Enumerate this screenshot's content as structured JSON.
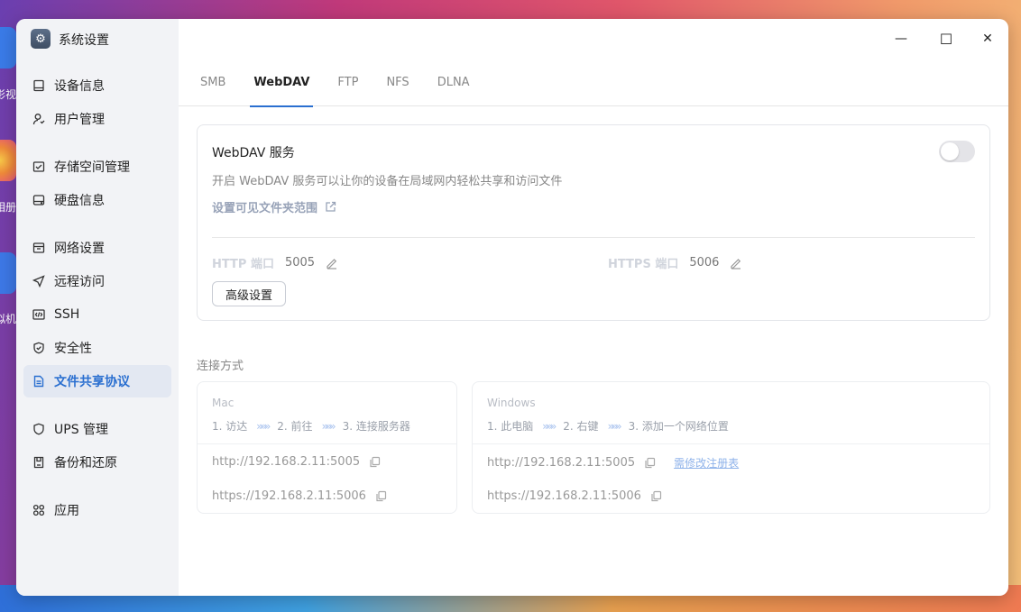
{
  "desktop": {
    "labels": [
      "影视",
      "相册",
      "虚拟机"
    ]
  },
  "window": {
    "title": "系统设置",
    "minimize_label": "—",
    "maximize_label": "☐",
    "close_label": "✕"
  },
  "sidebar": {
    "items": [
      {
        "label": "设备信息",
        "icon": "device-icon"
      },
      {
        "label": "用户管理",
        "icon": "user-icon"
      },
      {
        "label": "存储空间管理",
        "icon": "storage-icon"
      },
      {
        "label": "硬盘信息",
        "icon": "disk-icon"
      },
      {
        "label": "网络设置",
        "icon": "network-icon"
      },
      {
        "label": "远程访问",
        "icon": "send-icon"
      },
      {
        "label": "SSH",
        "icon": "code-icon"
      },
      {
        "label": "安全性",
        "icon": "shield-icon"
      },
      {
        "label": "文件共享协议",
        "icon": "file-icon",
        "active": true
      },
      {
        "label": "UPS 管理",
        "icon": "ups-shield-icon"
      },
      {
        "label": "备份和还原",
        "icon": "backup-icon"
      },
      {
        "label": "应用",
        "icon": "apps-icon"
      }
    ]
  },
  "tabs": [
    {
      "label": "SMB"
    },
    {
      "label": "WebDAV",
      "active": true
    },
    {
      "label": "FTP"
    },
    {
      "label": "NFS"
    },
    {
      "label": "DLNA"
    }
  ],
  "webdav": {
    "title": "WebDAV 服务",
    "enabled": false,
    "description": "开启 WebDAV 服务可以让你的设备在局域网内轻松共享和访问文件",
    "folder_scope_link": "设置可见文件夹范围",
    "http_port_label": "HTTP 端口",
    "http_port": "5005",
    "https_port_label": "HTTPS 端口",
    "https_port": "5006",
    "advanced_button": "高级设置"
  },
  "connection": {
    "title": "连接方式",
    "mac": {
      "os": "Mac",
      "steps": [
        "1. 访达",
        "2. 前往",
        "3. 连接服务器"
      ],
      "http_url": "http://192.168.2.11:5005",
      "https_url": "https://192.168.2.11:5006"
    },
    "windows": {
      "os": "Windows",
      "steps": [
        "1. 此电脑",
        "2. 右键",
        "3. 添加一个网络位置"
      ],
      "http_url": "http://192.168.2.11:5005",
      "registry_link": "需修改注册表",
      "https_url": "https://192.168.2.11:5006"
    },
    "step_arrow": "»»»"
  },
  "colors": {
    "accent": "#2a6fd0",
    "sidebar_bg": "#f2f3f6",
    "active_item_bg": "#e3e8f2"
  }
}
